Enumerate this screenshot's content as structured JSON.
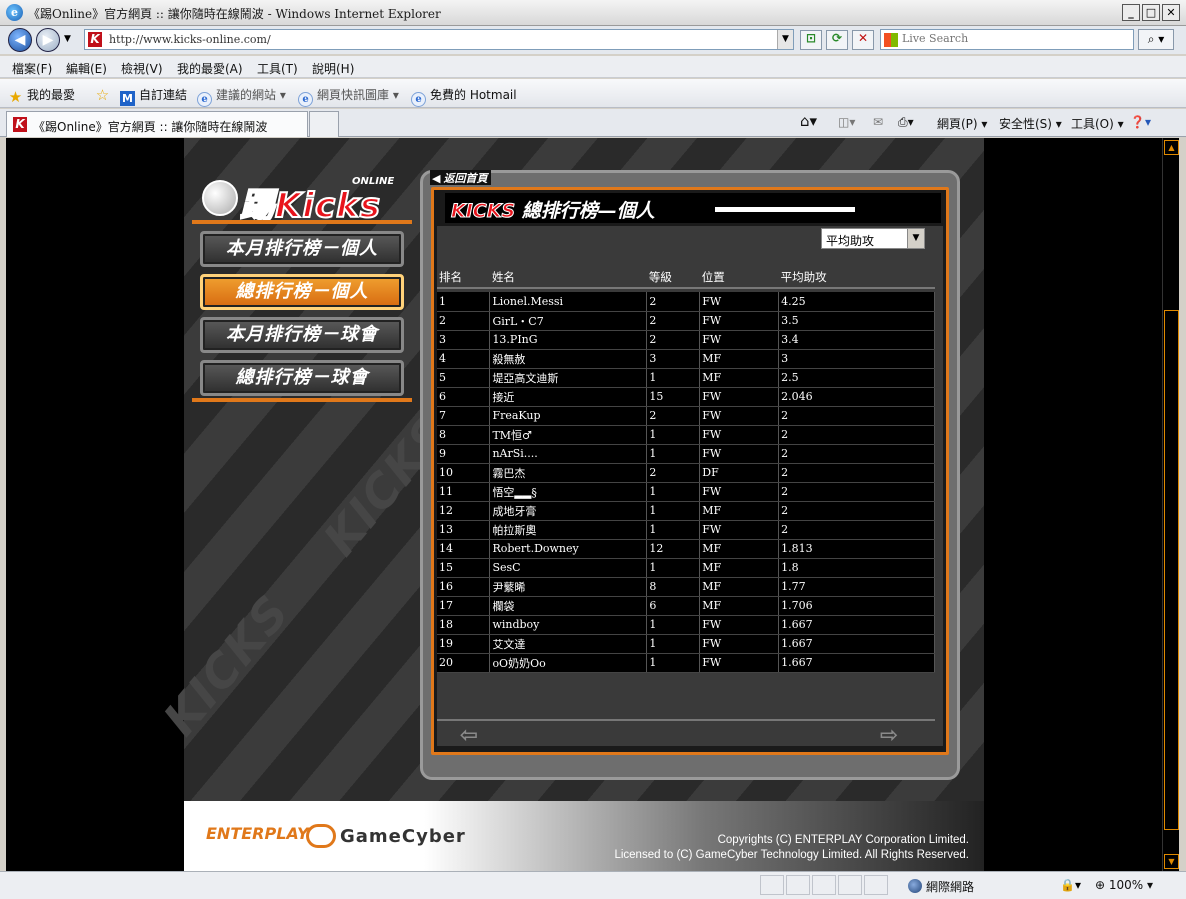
{
  "browser": {
    "window_title": "《踢Online》官方網頁 :: 讓你隨時在線鬧波 - Windows Internet Explorer",
    "url": "http://www.kicks-online.com/",
    "search_placeholder": "Live Search",
    "menu": [
      "檔案(F)",
      "編輯(E)",
      "檢視(V)",
      "我的最愛(A)",
      "工具(T)",
      "說明(H)"
    ],
    "favorites": {
      "favorites_label": "我的最愛",
      "items": [
        "自訂連結",
        "建議的網站 ▾",
        "網頁快訊圖庫 ▾",
        "免費的 Hotmail"
      ]
    },
    "tab_title": "《踢Online》官方網頁 :: 讓你隨時在線鬧波",
    "commands": [
      "網頁(P) ▾",
      "安全性(S) ▾",
      "工具(O) ▾"
    ],
    "status": {
      "zone": "網際網路",
      "zoom": "100%"
    }
  },
  "site": {
    "logo_text": "踢Kicks",
    "logo_sub": "ONLINE",
    "nav": [
      {
        "label": "本月排行榜－個人",
        "active": false
      },
      {
        "label": "總排行榜－個人",
        "active": true
      },
      {
        "label": "本月排行榜－球會",
        "active": false
      },
      {
        "label": "總排行榜－球會",
        "active": false
      }
    ],
    "back_label": "返回首頁",
    "panel_title_brand": "KICKS",
    "panel_title": "總排行榜—個人",
    "sort_select": "平均助攻",
    "columns": [
      "排名",
      "姓名",
      "等級",
      "位置",
      "平均助攻"
    ],
    "rows": [
      [
        "1",
        "Lionel.Messi",
        "2",
        "FW",
        "4.25"
      ],
      [
        "2",
        "GirL・C7",
        "2",
        "FW",
        "3.5"
      ],
      [
        "3",
        "13.PInG",
        "2",
        "FW",
        "3.4"
      ],
      [
        "4",
        "殺無赦",
        "3",
        "MF",
        "3"
      ],
      [
        "5",
        "堤亞高文迪斯",
        "1",
        "MF",
        "2.5"
      ],
      [
        "6",
        "接近",
        "15",
        "FW",
        "2.046"
      ],
      [
        "7",
        "FreaKup",
        "2",
        "FW",
        "2"
      ],
      [
        "8",
        "TM恒♂",
        "1",
        "FW",
        "2"
      ],
      [
        "9",
        "nArSi....",
        "1",
        "FW",
        "2"
      ],
      [
        "10",
        "霧巴杰",
        "2",
        "DF",
        "2"
      ],
      [
        "11",
        "悟空▂▂§",
        "1",
        "FW",
        "2"
      ],
      [
        "12",
        "成地牙膏",
        "1",
        "MF",
        "2"
      ],
      [
        "13",
        "帕拉斯奧",
        "1",
        "FW",
        "2"
      ],
      [
        "14",
        "Robert.Downey",
        "12",
        "MF",
        "1.813"
      ],
      [
        "15",
        "SesC",
        "1",
        "MF",
        "1.8"
      ],
      [
        "16",
        "尹蘩晞",
        "8",
        "MF",
        "1.77"
      ],
      [
        "17",
        "欄袋",
        "6",
        "MF",
        "1.706"
      ],
      [
        "18",
        "windboy",
        "1",
        "FW",
        "1.667"
      ],
      [
        "19",
        "艾文達",
        "1",
        "FW",
        "1.667"
      ],
      [
        "20",
        "oO奶奶Oo",
        "1",
        "FW",
        "1.667"
      ]
    ],
    "footer": {
      "enterplay": "ENTERPLAY",
      "gamecyber": "GameCyber",
      "copyright_1": "Copyrights (C) ENTERPLAY Corporation Limited.",
      "copyright_2": "Licensed to (C) GameCyber Technology Limited. All Rights Reserved."
    }
  },
  "colors": {
    "accent_orange": "#e0781a",
    "brand_red": "#e8141c"
  }
}
